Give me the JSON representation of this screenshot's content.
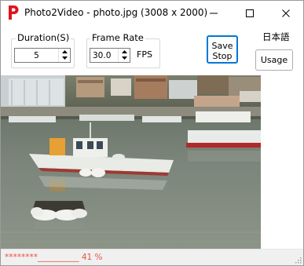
{
  "window": {
    "title": "Photo2Video - photo.jpg (3008 x 2000)",
    "app_icon": "letter-p-icon",
    "accent_color": "#e0141e"
  },
  "duration": {
    "label": "Duration(S)",
    "value": "5"
  },
  "frame_rate": {
    "label": "Frame Rate",
    "value": "30.0",
    "unit": "FPS"
  },
  "buttons": {
    "save_stop_line1": "Save",
    "save_stop_line2": "Stop",
    "usage": "Usage"
  },
  "language": {
    "label": "日本語"
  },
  "status": {
    "progress_text": "********__________ 41 %",
    "progress_color": "#e8533f"
  }
}
